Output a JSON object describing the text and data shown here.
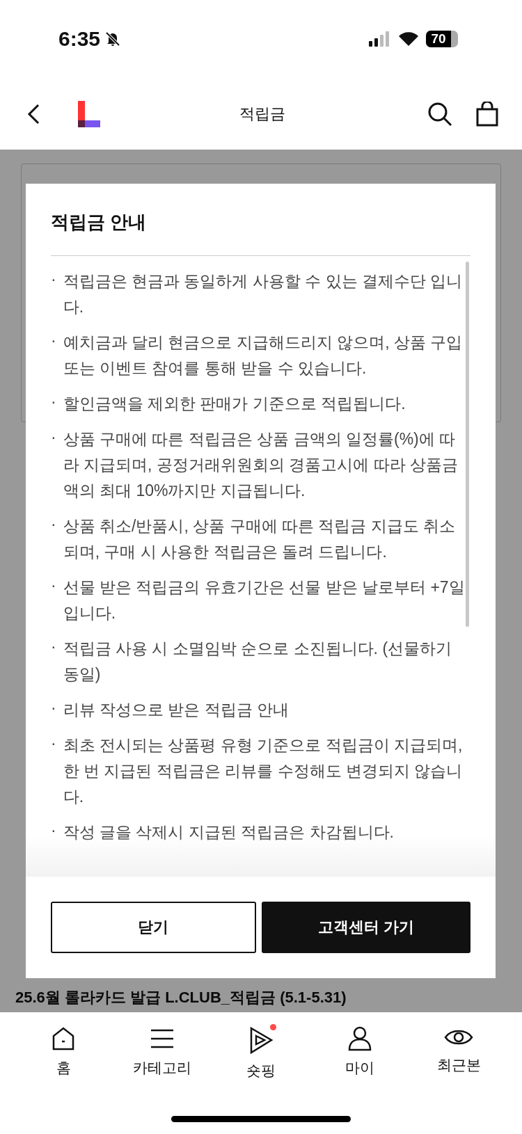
{
  "status_bar": {
    "time": "6:35",
    "battery": "70"
  },
  "header": {
    "title": "적립금"
  },
  "background": {
    "last_item": {
      "title": "25.6월 롤라카드 발급 L.CLUB_적립금 (5.1-5.31)"
    }
  },
  "modal": {
    "title": "적립금 안내",
    "items": [
      {
        "bullet": "·",
        "text": "적립금은 현금과 동일하게 사용할 수 있는 결제수단 입니다."
      },
      {
        "bullet": "·",
        "text": "예치금과 달리 현금으로 지급해드리지 않으며, 상품 구입 또는 이벤트 참여를 통해 받을 수 있습니다."
      },
      {
        "bullet": "·",
        "text": "할인금액을 제외한 판매가 기준으로 적립됩니다."
      },
      {
        "bullet": "·",
        "text": "상품 구매에 따른 적립금은 상품 금액의 일정률(%)에 따라 지급되며, 공정거래위원회의 경품고시에 따라 상품금액의 최대 10%까지만 지급됩니다."
      },
      {
        "bullet": "·",
        "text": "상품 취소/반품시, 상품 구매에 따른 적립금 지급도 취소되며, 구매 시 사용한 적립금은 돌려 드립니다."
      },
      {
        "bullet": "·",
        "text": "선물 받은 적립금의 유효기간은 선물 받은 날로부터 +7일입니다."
      },
      {
        "bullet": "·",
        "text": "적립금 사용 시 소멸임박 순으로 소진됩니다. (선물하기 동일)"
      },
      {
        "bullet": "·",
        "text": "리뷰 작성으로 받은 적립금 안내"
      },
      {
        "bullet": "·",
        "text": "최초 전시되는 상품평 유형 기준으로 적립금이 지급되며, 한 번 지급된 적립금은 리뷰를 수정해도 변경되지 않습니다."
      },
      {
        "bullet": "·",
        "text": "작성 글을 삭제시 지급된 적립금은 차감됩니다."
      }
    ],
    "buttons": [
      {
        "label": "닫기",
        "kind": "secondary"
      },
      {
        "label": "고객센터 가기",
        "kind": "primary"
      }
    ]
  },
  "bottom_nav": [
    {
      "label": "홈",
      "badge": false
    },
    {
      "label": "카테고리",
      "badge": false
    },
    {
      "label": "숏핑",
      "badge": true
    },
    {
      "label": "마이",
      "badge": false
    },
    {
      "label": "최근본",
      "badge": false
    }
  ]
}
